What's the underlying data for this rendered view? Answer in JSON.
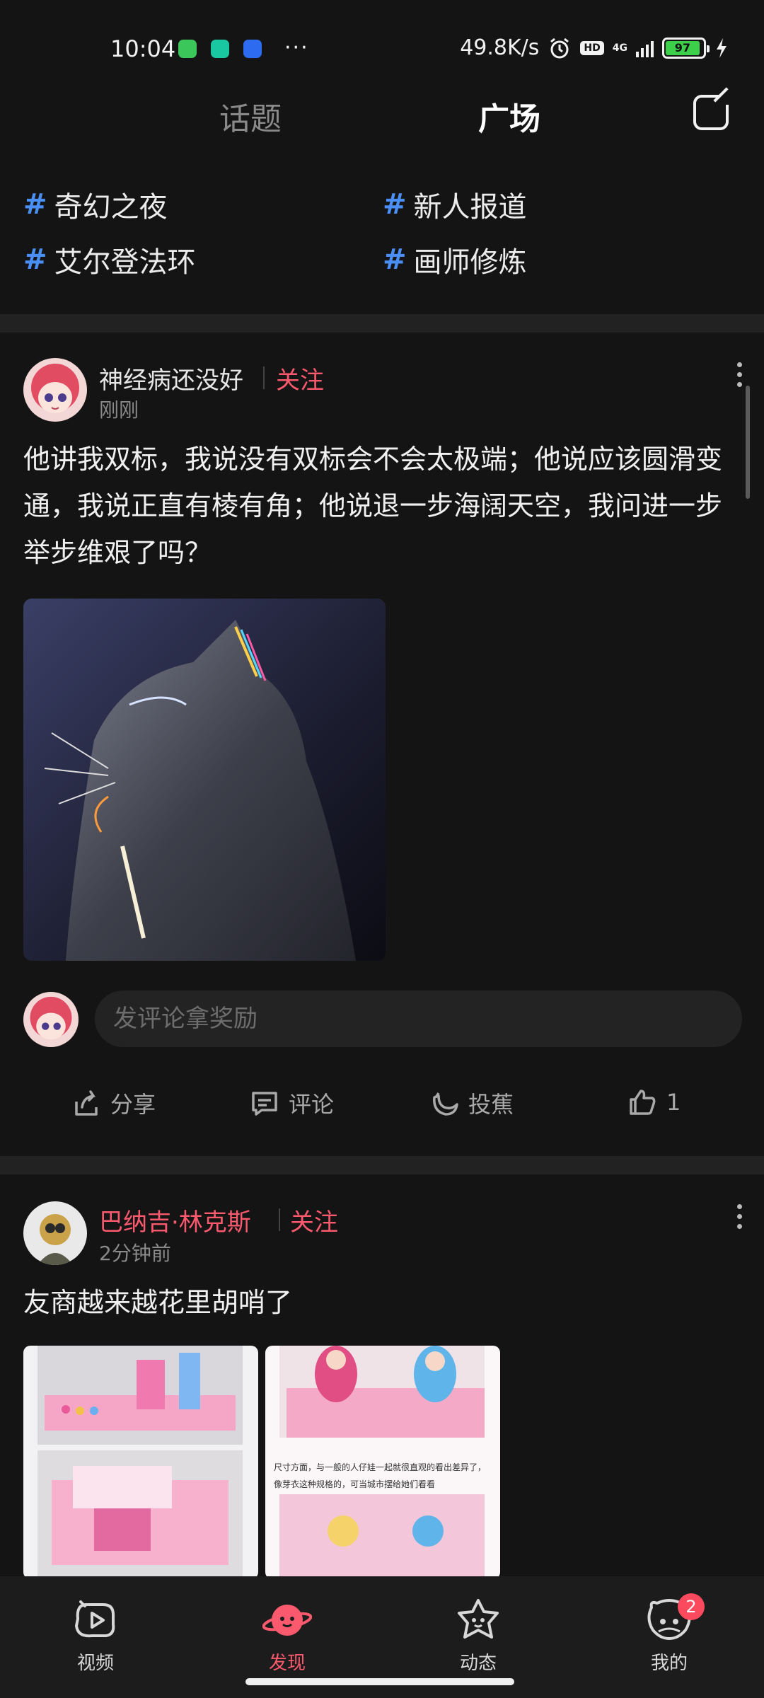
{
  "status_bar": {
    "time": "10:04",
    "more": "···",
    "net_speed": "49.8K/s",
    "hd": "HD",
    "network": "4G",
    "battery": "97"
  },
  "header": {
    "tabs": [
      {
        "label": "话题"
      },
      {
        "label": "广场"
      }
    ],
    "active_tab": "广场"
  },
  "topics": [
    {
      "hash": "#",
      "label": "奇幻之夜"
    },
    {
      "hash": "#",
      "label": "新人报道"
    },
    {
      "hash": "#",
      "label": "艾尔登法环"
    },
    {
      "hash": "#",
      "label": "画师修炼"
    }
  ],
  "posts": [
    {
      "user": "神经病还没好",
      "follow": "关注",
      "time": "刚刚",
      "text": "他讲我双标，我说没有双标会不会太极端；他说应该圆滑变通，我说正直有棱有角；他说退一步海阔天空，我问进一步举步维艰了吗？",
      "comment_placeholder": "发评论拿奖励",
      "actions": {
        "share": "分享",
        "comment": "评论",
        "banana": "投蕉",
        "like_count": "1"
      }
    },
    {
      "user": "巴纳吉·林克斯",
      "follow": "关注",
      "time": "2分钟前",
      "text": "友商越来越花里胡哨了",
      "image_text": "尺寸方面，与一般的人仔娃一起就很直观的看出差异了，像芽衣这种规格的，可当城市摆给她们看看"
    }
  ],
  "bottom_nav": [
    {
      "label": "视频",
      "icon": "video-icon"
    },
    {
      "label": "发现",
      "icon": "planet-icon"
    },
    {
      "label": "动态",
      "icon": "star-face-icon"
    },
    {
      "label": "我的",
      "icon": "profile-icon",
      "badge": "2"
    }
  ],
  "colors": {
    "accent": "#fb5a6e",
    "hashtag": "#4a8ff5",
    "background": "#141414"
  }
}
